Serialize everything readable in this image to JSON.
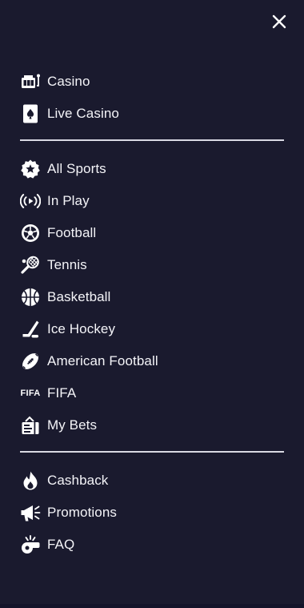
{
  "theme": {
    "background": "#1a1a2e",
    "text": "#ffffff",
    "divider": "#d9d9e3"
  },
  "header": {
    "close_icon": "close-icon"
  },
  "sections": [
    {
      "items": [
        {
          "label": "Casino",
          "icon": "slot-machine-icon"
        },
        {
          "label": "Live Casino",
          "icon": "playing-card-icon"
        }
      ]
    },
    {
      "items": [
        {
          "label": "All Sports",
          "icon": "sports-star-icon"
        },
        {
          "label": "In Play",
          "icon": "broadcast-icon"
        },
        {
          "label": "Football",
          "icon": "soccer-ball-icon"
        },
        {
          "label": "Tennis",
          "icon": "tennis-racket-icon"
        },
        {
          "label": "Basketball",
          "icon": "basketball-icon"
        },
        {
          "label": "Ice Hockey",
          "icon": "hockey-stick-icon"
        },
        {
          "label": "American Football",
          "icon": "american-football-icon"
        },
        {
          "label": "FIFA",
          "icon": "fifa-logo-icon",
          "icon_text": "FIFA"
        },
        {
          "label": "My Bets",
          "icon": "bet-slip-icon"
        }
      ]
    },
    {
      "items": [
        {
          "label": "Cashback",
          "icon": "flame-icon"
        },
        {
          "label": "Promotions",
          "icon": "megaphone-icon"
        },
        {
          "label": "FAQ",
          "icon": "whistle-icon"
        }
      ]
    }
  ]
}
